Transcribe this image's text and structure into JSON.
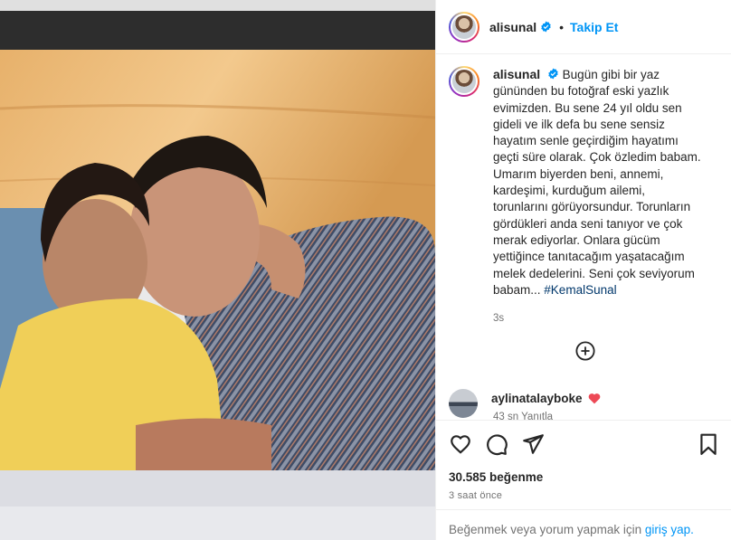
{
  "post": {
    "username": "alisunal",
    "follow_label": "Takip Et",
    "dot": "•",
    "caption_text": "Bugün gibi bir yaz gününden bu fotoğraf eski yazlık evimizden. Bu sene 24 yıl oldu sen gideli ve ilk defa bu sene sensiz hayatım senle geçirdiğim hayatımı geçti süre olarak. Çok özledim babam. Umarım biyerden beni, annemi, kardeşimi, kurduğum ailemi, torunlarını görüyorsundur. Torunların gördükleri anda seni tanıyor ve çok merak ediyorlar. Onlara gücüm yettiğince tanıtacağım yaşatacağım melek dedelerini. Seni çok seviyorum babam...",
    "hashtag": "#KemalSunal",
    "caption_time": "3s"
  },
  "comment": {
    "username": "aylinatalayboke",
    "partial_meta": "43 sn  Yanıtla"
  },
  "stats": {
    "likes": "30.585 beğenme",
    "posted_ago": "3 saat önce"
  },
  "login_prompt": {
    "text": "Beğenmek veya yorum yapmak için",
    "link": "giriş yap."
  },
  "icons": {
    "verified": "verified-badge-icon",
    "heart": "heart-icon",
    "comment": "comment-icon",
    "share": "share-icon",
    "save": "bookmark-icon",
    "more_comments": "plus-circle-icon"
  },
  "colors": {
    "accent": "#0095f6",
    "hashtag": "#00376b",
    "muted": "#737373",
    "heart_red": "#ed4956"
  }
}
